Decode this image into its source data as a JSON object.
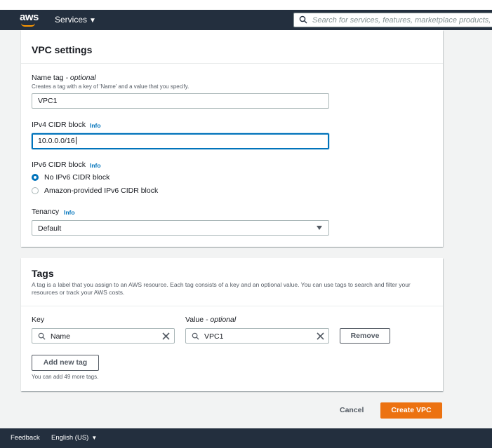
{
  "nav": {
    "logo_text": "aws",
    "services_label": "Services",
    "services_caret": "▼",
    "search_placeholder": "Search for services, features, marketplace products, and docs"
  },
  "vpc_settings": {
    "title": "VPC settings",
    "name_tag": {
      "label": "Name tag",
      "optional": " - optional",
      "hint": "Creates a tag with a key of 'Name' and a value that you specify.",
      "value": "VPC1"
    },
    "ipv4": {
      "label": "IPv4 CIDR block",
      "info": "Info",
      "value": "10.0.0.0/16"
    },
    "ipv6": {
      "label": "IPv6 CIDR block",
      "info": "Info",
      "options": [
        {
          "label": "No IPv6 CIDR block",
          "selected": true
        },
        {
          "label": "Amazon-provided IPv6 CIDR block",
          "selected": false
        }
      ]
    },
    "tenancy": {
      "label": "Tenancy",
      "info": "Info",
      "selected": "Default"
    }
  },
  "tags": {
    "title": "Tags",
    "description": "A tag is a label that you assign to an AWS resource. Each tag consists of a key and an optional value. You can use tags to search and filter your resources or track your AWS costs.",
    "key_label": "Key",
    "value_label": "Value",
    "value_optional": " - optional",
    "rows": [
      {
        "key": "Name",
        "value": "VPC1"
      }
    ],
    "remove_label": "Remove",
    "add_label": "Add new tag",
    "limit_hint": "You can add 49 more tags."
  },
  "actions": {
    "cancel": "Cancel",
    "create": "Create VPC"
  },
  "footer": {
    "feedback": "Feedback",
    "language": "English (US)",
    "language_caret": "▼"
  },
  "colors": {
    "nav_bg": "#232f3e",
    "primary_button": "#ec7211",
    "link_blue": "#0073bb",
    "accent_orange": "#ff9900"
  }
}
